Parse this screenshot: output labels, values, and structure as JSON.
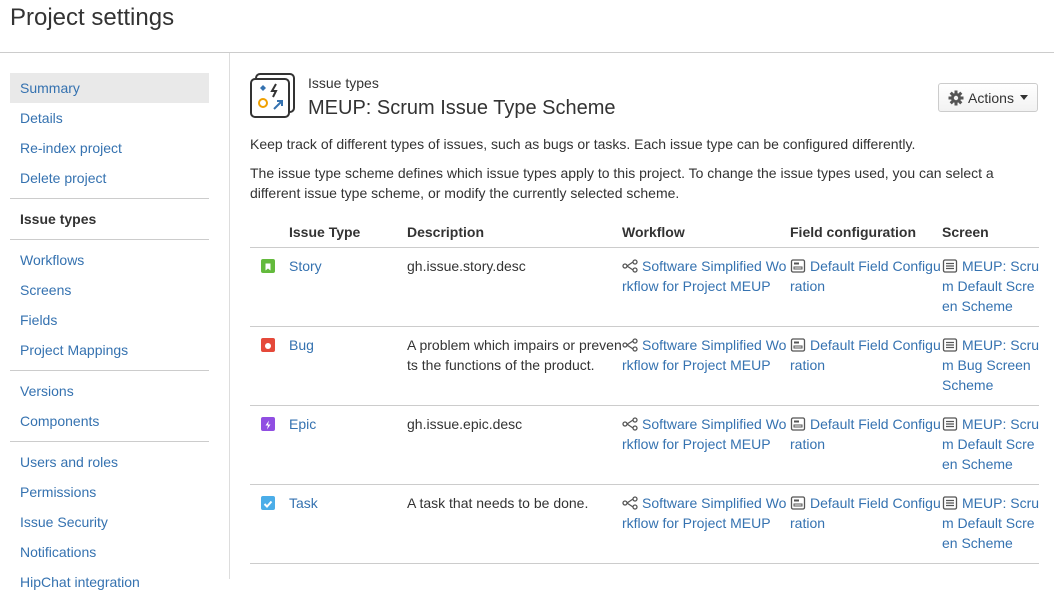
{
  "page": {
    "title": "Project settings"
  },
  "sidebar": {
    "groups": [
      {
        "items": [
          {
            "label": "Summary",
            "selected": true
          },
          {
            "label": "Details"
          },
          {
            "label": "Re-index project"
          },
          {
            "label": "Delete project"
          }
        ]
      },
      {
        "items": [
          {
            "label": "Issue types",
            "heading": true
          }
        ]
      },
      {
        "items": [
          {
            "label": "Workflows"
          },
          {
            "label": "Screens"
          },
          {
            "label": "Fields"
          },
          {
            "label": "Project Mappings"
          }
        ]
      },
      {
        "items": [
          {
            "label": "Versions"
          },
          {
            "label": "Components"
          }
        ]
      },
      {
        "items": [
          {
            "label": "Users and roles"
          },
          {
            "label": "Permissions"
          },
          {
            "label": "Issue Security"
          },
          {
            "label": "Notifications"
          },
          {
            "label": "HipChat integration"
          }
        ]
      }
    ]
  },
  "main": {
    "kicker": "Issue types",
    "title": "MEUP: Scrum Issue Type Scheme",
    "actions_label": "Actions",
    "intro_1": "Keep track of different types of issues, such as bugs or tasks. Each issue type can be configured differently.",
    "intro_2": "The issue type scheme defines which issue types apply to this project. To change the issue types used, you can select a different issue type scheme, or modify the currently selected scheme."
  },
  "table": {
    "headers": {
      "issue_type": "Issue Type",
      "description": "Description",
      "workflow": "Workflow",
      "field_config": "Field configuration",
      "screen": "Screen"
    },
    "rows": [
      {
        "type": "Story",
        "icon": "story-icon",
        "color": "#63ba3c",
        "description": "gh.issue.story.desc",
        "workflow": "Software Simplified Workflow for Project MEUP",
        "field_config": "Default Field Configuration",
        "screen": "MEUP: Scrum Default Screen Scheme"
      },
      {
        "type": "Bug",
        "icon": "bug-icon",
        "color": "#e5493a",
        "description": "A problem which impairs or prevents the functions of the product.",
        "workflow": "Software Simplified Workflow for Project MEUP",
        "field_config": "Default Field Configuration",
        "screen": "MEUP: Scrum Bug Screen Scheme"
      },
      {
        "type": "Epic",
        "icon": "epic-icon",
        "color": "#904ee2",
        "description": "gh.issue.epic.desc",
        "workflow": "Software Simplified Workflow for Project MEUP",
        "field_config": "Default Field Configuration",
        "screen": "MEUP: Scrum Default Screen Scheme"
      },
      {
        "type": "Task",
        "icon": "task-icon",
        "color": "#4bade8",
        "description": "A task that needs to be done.",
        "workflow": "Software Simplified Workflow for Project MEUP",
        "field_config": "Default Field Configuration",
        "screen": "MEUP: Scrum Default Screen Scheme"
      }
    ]
  }
}
